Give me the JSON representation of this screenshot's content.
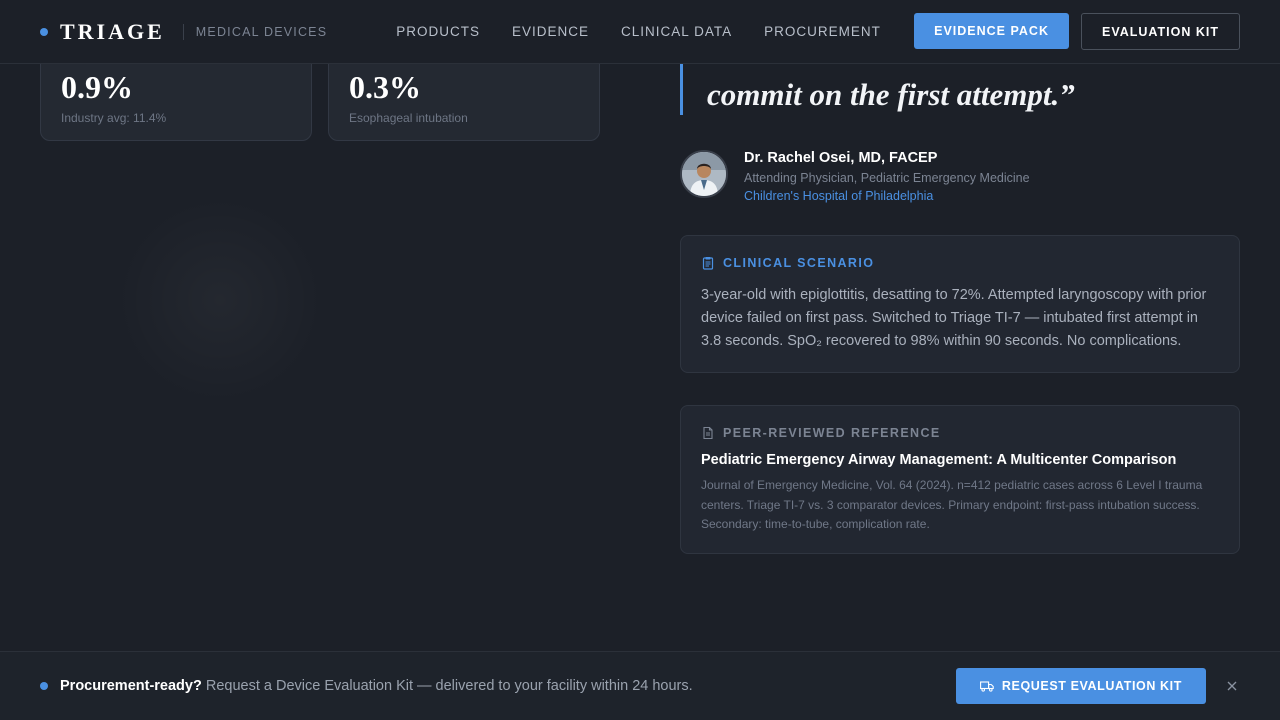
{
  "header": {
    "brand": "TRIAGE",
    "subtitle": "MEDICAL DEVICES",
    "nav": [
      "PRODUCTS",
      "EVIDENCE",
      "CLINICAL DATA",
      "PROCUREMENT"
    ],
    "primary_button": "EVIDENCE PACK",
    "secondary_button": "EVALUATION KIT"
  },
  "stats": [
    {
      "value": "0.9%",
      "caption": "Industry avg: 11.4%"
    },
    {
      "value": "0.3%",
      "caption": "Esophageal intubation"
    }
  ],
  "quote": {
    "text": "commit on the first attempt.”"
  },
  "author": {
    "name": "Dr. Rachel Osei, MD, FACEP",
    "role": "Attending Physician, Pediatric Emergency Medicine",
    "org": "Children's Hospital of Philadelphia"
  },
  "scenario": {
    "label": "CLINICAL SCENARIO",
    "text": "3-year-old with epiglottitis, desatting to 72%. Attempted laryngoscopy with prior device failed on first pass. Switched to Triage TI-7 — intubated first attempt in 3.8 seconds. SpO₂ recovered to 98% within 90 seconds. No complications."
  },
  "reference": {
    "label": "PEER-REVIEWED REFERENCE",
    "title": "Pediatric Emergency Airway Management: A Multicenter Comparison",
    "text": "Journal of Emergency Medicine, Vol. 64 (2024). n=412 pediatric cases across 6 Level I trauma centers. Triage TI-7 vs. 3 comparator devices. Primary endpoint: first-pass intubation success. Secondary: time-to-tube, complication rate."
  },
  "bottom_bar": {
    "strong": "Procurement-ready?",
    "text": " Request a Device Evaluation Kit — delivered to your facility within 24 hours.",
    "button": "REQUEST EVALUATION KIT"
  },
  "icons": {
    "scenario": "clipboard-icon",
    "reference": "document-icon",
    "truck": "truck-icon",
    "close": "close-icon"
  },
  "colors": {
    "accent": "#4a90e2",
    "background": "#1c2028",
    "card": "#242932"
  }
}
